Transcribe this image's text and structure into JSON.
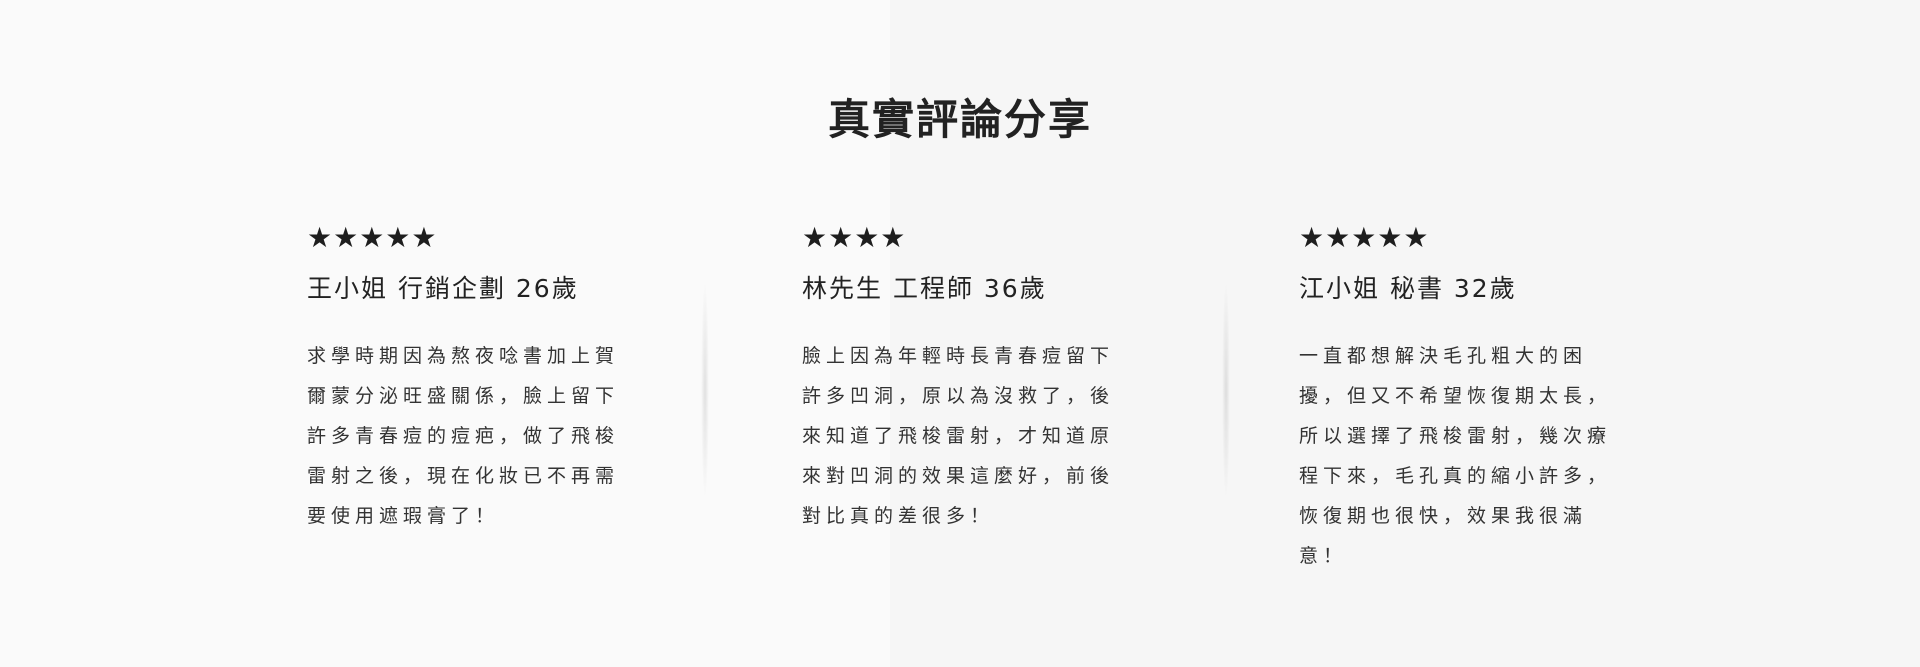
{
  "section": {
    "title": "真實評論分享"
  },
  "reviews": [
    {
      "stars": "★★★★★",
      "name": "王小姐 行銷企劃 26歲",
      "text": "求學時期因為熬夜唸書加上賀爾蒙分泌旺盛關係，臉上留下許多青春痘的痘疤，做了飛梭雷射之後，現在化妝已不再需要使用遮瑕膏了！"
    },
    {
      "stars": "★★★★",
      "name": "林先生 工程師 36歲",
      "text": "臉上因為年輕時長青春痘留下許多凹洞，原以為沒救了，後來知道了飛梭雷射，才知道原來對凹洞的效果這麼好，前後對比真的差很多！"
    },
    {
      "stars": "★★★★★",
      "name": "江小姐 秘書 32歲",
      "text": "一直都想解決毛孔粗大的困擾，但又不希望恢復期太長，所以選擇了飛梭雷射，幾次療程下來，毛孔真的縮小許多，恢復期也很快，效果我很滿意！"
    }
  ]
}
